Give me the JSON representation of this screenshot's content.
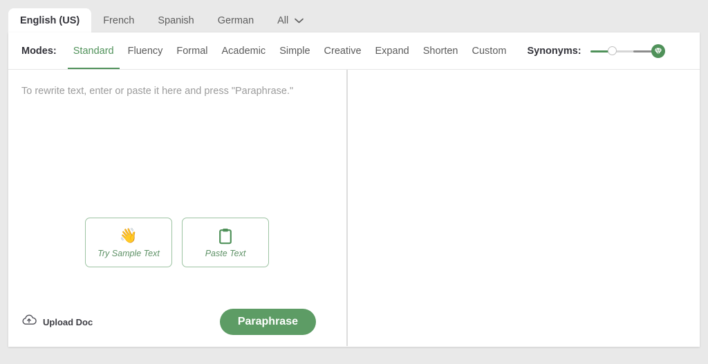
{
  "language_tabs": {
    "items": [
      {
        "label": "English (US)",
        "active": true
      },
      {
        "label": "French",
        "active": false
      },
      {
        "label": "Spanish",
        "active": false
      },
      {
        "label": "German",
        "active": false
      },
      {
        "label": "All",
        "active": false,
        "icon": "chevron-down-icon"
      }
    ]
  },
  "modes_bar": {
    "label": "Modes:",
    "items": [
      {
        "label": "Standard",
        "active": true
      },
      {
        "label": "Fluency",
        "active": false
      },
      {
        "label": "Formal",
        "active": false
      },
      {
        "label": "Academic",
        "active": false
      },
      {
        "label": "Simple",
        "active": false
      },
      {
        "label": "Creative",
        "active": false
      },
      {
        "label": "Expand",
        "active": false
      },
      {
        "label": "Shorten",
        "active": false
      },
      {
        "label": "Custom",
        "active": false
      }
    ],
    "synonyms": {
      "label": "Synonyms:",
      "value": 24,
      "min": 0,
      "max": 100,
      "premium_icon": "gem-icon"
    }
  },
  "input_pane": {
    "placeholder": "To rewrite text, enter or paste it here and press \"Paraphrase.\"",
    "value": "",
    "starter_buttons": [
      {
        "label": "Try Sample Text",
        "icon": "waving-hand-icon",
        "glyph": "👋"
      },
      {
        "label": "Paste Text",
        "icon": "clipboard-icon"
      }
    ]
  },
  "output_pane": {
    "text": ""
  },
  "footer": {
    "upload_label": "Upload Doc",
    "upload_icon": "cloud-upload-icon",
    "paraphrase_label": "Paraphrase"
  },
  "colors": {
    "accent_green": "#4f9159",
    "button_green": "#5d9c65",
    "page_background": "#e9e9e9",
    "card_background": "#ffffff",
    "placeholder_text": "#9b9b9b",
    "border": "#e6e6e6"
  }
}
